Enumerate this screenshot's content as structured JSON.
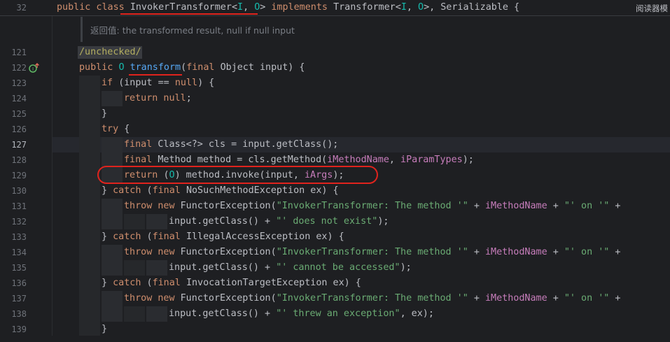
{
  "side_tab": "阅读器模",
  "doc_hint": {
    "label": "返回值:",
    "text": " the transformed result, null if null input"
  },
  "header": {
    "line_no": "32",
    "parts": [
      {
        "t": "public class ",
        "c": "kw"
      },
      {
        "t": "InvokerTransformer",
        "c": "plain"
      },
      {
        "t": "<",
        "c": "plain"
      },
      {
        "t": "I",
        "c": "tp"
      },
      {
        "t": ", ",
        "c": "plain"
      },
      {
        "t": "O",
        "c": "tp"
      },
      {
        "t": "> ",
        "c": "plain"
      },
      {
        "t": "implements ",
        "c": "kw"
      },
      {
        "t": "Transformer<",
        "c": "plain"
      },
      {
        "t": "I",
        "c": "tp"
      },
      {
        "t": ", ",
        "c": "plain"
      },
      {
        "t": "O",
        "c": "tp"
      },
      {
        "t": ">, Serializable {",
        "c": "plain"
      }
    ]
  },
  "lines": [
    {
      "no": "121",
      "indent": 1,
      "parts": [
        {
          "t": "/unchecked/",
          "c": "ann"
        }
      ]
    },
    {
      "no": "122",
      "indent": 1,
      "parts": [
        {
          "t": "public ",
          "c": "kw"
        },
        {
          "t": "O ",
          "c": "tp"
        },
        {
          "t": "transform",
          "c": "mth"
        },
        {
          "t": "(",
          "c": "plain"
        },
        {
          "t": "final ",
          "c": "kw"
        },
        {
          "t": "Object input) {",
          "c": "plain"
        }
      ]
    },
    {
      "no": "123",
      "indent": 2,
      "parts": [
        {
          "t": "if ",
          "c": "kw"
        },
        {
          "t": "(input == ",
          "c": "plain"
        },
        {
          "t": "null",
          "c": "kw"
        },
        {
          "t": ") {",
          "c": "plain"
        }
      ]
    },
    {
      "no": "124",
      "indent": 3,
      "parts": [
        {
          "t": "return null",
          "c": "kw"
        },
        {
          "t": ";",
          "c": "plain"
        }
      ]
    },
    {
      "no": "125",
      "indent": 2,
      "parts": [
        {
          "t": "}",
          "c": "plain"
        }
      ]
    },
    {
      "no": "126",
      "indent": 2,
      "parts": [
        {
          "t": "try ",
          "c": "kw"
        },
        {
          "t": "{",
          "c": "plain"
        }
      ]
    },
    {
      "no": "127",
      "indent": 3,
      "parts": [
        {
          "t": "final ",
          "c": "kw"
        },
        {
          "t": "Class<?> cls = input.getClass();",
          "c": "plain"
        }
      ]
    },
    {
      "no": "128",
      "indent": 3,
      "parts": [
        {
          "t": "final ",
          "c": "kw"
        },
        {
          "t": "Method method = cls.getMethod(",
          "c": "plain"
        },
        {
          "t": "iMethodName",
          "c": "fld"
        },
        {
          "t": ", ",
          "c": "plain"
        },
        {
          "t": "iParamTypes",
          "c": "fld"
        },
        {
          "t": ");",
          "c": "plain"
        }
      ]
    },
    {
      "no": "129",
      "indent": 3,
      "parts": [
        {
          "t": "return ",
          "c": "kw"
        },
        {
          "t": "(",
          "c": "plain"
        },
        {
          "t": "O",
          "c": "tp"
        },
        {
          "t": ") method.invoke(input, ",
          "c": "plain"
        },
        {
          "t": "iArgs",
          "c": "fld"
        },
        {
          "t": ");",
          "c": "plain"
        }
      ]
    },
    {
      "no": "130",
      "indent": 2,
      "parts": [
        {
          "t": "} ",
          "c": "plain"
        },
        {
          "t": "catch ",
          "c": "kw"
        },
        {
          "t": "(",
          "c": "plain"
        },
        {
          "t": "final ",
          "c": "kw"
        },
        {
          "t": "NoSuchMethodException ex) {",
          "c": "plain"
        }
      ]
    },
    {
      "no": "131",
      "indent": 3,
      "parts": [
        {
          "t": "throw new ",
          "c": "kw"
        },
        {
          "t": "FunctorException(",
          "c": "plain"
        },
        {
          "t": "\"InvokerTransformer: The method '\"",
          "c": "str"
        },
        {
          "t": " + ",
          "c": "plain"
        },
        {
          "t": "iMethodName",
          "c": "fld"
        },
        {
          "t": " + ",
          "c": "plain"
        },
        {
          "t": "\"' on '\"",
          "c": "str"
        },
        {
          "t": " +",
          "c": "plain"
        }
      ]
    },
    {
      "no": "132",
      "indent": 5,
      "parts": [
        {
          "t": "input.getClass() + ",
          "c": "plain"
        },
        {
          "t": "\"' does not exist\"",
          "c": "str"
        },
        {
          "t": ");",
          "c": "plain"
        }
      ]
    },
    {
      "no": "133",
      "indent": 2,
      "parts": [
        {
          "t": "} ",
          "c": "plain"
        },
        {
          "t": "catch ",
          "c": "kw"
        },
        {
          "t": "(",
          "c": "plain"
        },
        {
          "t": "final ",
          "c": "kw"
        },
        {
          "t": "IllegalAccessException ex) {",
          "c": "plain"
        }
      ]
    },
    {
      "no": "134",
      "indent": 3,
      "parts": [
        {
          "t": "throw new ",
          "c": "kw"
        },
        {
          "t": "FunctorException(",
          "c": "plain"
        },
        {
          "t": "\"InvokerTransformer: The method '\"",
          "c": "str"
        },
        {
          "t": " + ",
          "c": "plain"
        },
        {
          "t": "iMethodName",
          "c": "fld"
        },
        {
          "t": " + ",
          "c": "plain"
        },
        {
          "t": "\"' on '\"",
          "c": "str"
        },
        {
          "t": " +",
          "c": "plain"
        }
      ]
    },
    {
      "no": "135",
      "indent": 5,
      "parts": [
        {
          "t": "input.getClass() + ",
          "c": "plain"
        },
        {
          "t": "\"' cannot be accessed\"",
          "c": "str"
        },
        {
          "t": ");",
          "c": "plain"
        }
      ]
    },
    {
      "no": "136",
      "indent": 2,
      "parts": [
        {
          "t": "} ",
          "c": "plain"
        },
        {
          "t": "catch ",
          "c": "kw"
        },
        {
          "t": "(",
          "c": "plain"
        },
        {
          "t": "final ",
          "c": "kw"
        },
        {
          "t": "InvocationTargetException ex) {",
          "c": "plain"
        }
      ]
    },
    {
      "no": "137",
      "indent": 3,
      "parts": [
        {
          "t": "throw new ",
          "c": "kw"
        },
        {
          "t": "FunctorException(",
          "c": "plain"
        },
        {
          "t": "\"InvokerTransformer: The method '\"",
          "c": "str"
        },
        {
          "t": " + ",
          "c": "plain"
        },
        {
          "t": "iMethodName",
          "c": "fld"
        },
        {
          "t": " + ",
          "c": "plain"
        },
        {
          "t": "\"' on '\"",
          "c": "str"
        },
        {
          "t": " +",
          "c": "plain"
        }
      ]
    },
    {
      "no": "138",
      "indent": 5,
      "parts": [
        {
          "t": "input.getClass() + ",
          "c": "plain"
        },
        {
          "t": "\"' threw an exception\"",
          "c": "str"
        },
        {
          "t": ", ex);",
          "c": "plain"
        }
      ]
    },
    {
      "no": "139",
      "indent": 2,
      "parts": [
        {
          "t": "}",
          "c": "plain"
        }
      ]
    }
  ],
  "current_line": "127",
  "gutter_icon": "override-implement-icon",
  "colors": {
    "background": "#1e1f22",
    "keyword": "#cf8e6d",
    "string": "#6aab73",
    "field": "#c77dbb",
    "method": "#56a8f5",
    "type_param": "#16baac",
    "annotation_mark": "#e0231d"
  }
}
